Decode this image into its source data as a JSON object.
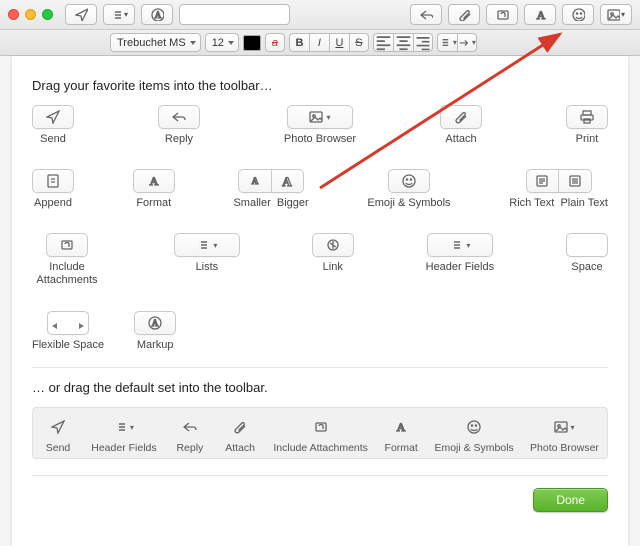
{
  "formatbar": {
    "font": "Trebuchet MS",
    "size": "12"
  },
  "sheet": {
    "instruction": "Drag your favorite items into the toolbar…",
    "or_instruction": "… or drag the default set into the toolbar.",
    "done": "Done"
  },
  "items": {
    "send": "Send",
    "reply": "Reply",
    "photo_browser": "Photo Browser",
    "attach": "Attach",
    "print": "Print",
    "append": "Append",
    "format": "Format",
    "smaller": "Smaller",
    "bigger": "Bigger",
    "emoji": "Emoji & Symbols",
    "rich_text": "Rich Text",
    "plain_text": "Plain Text",
    "include_attachments": "Include Attachments",
    "lists": "Lists",
    "link": "Link",
    "header_fields": "Header Fields",
    "space": "Space",
    "flexible_space": "Flexible Space",
    "markup": "Markup"
  },
  "defaults": {
    "send": "Send",
    "header_fields": "Header Fields",
    "reply": "Reply",
    "attach": "Attach",
    "include_attachments": "Include Attachments",
    "format": "Format",
    "emoji": "Emoji & Symbols",
    "photo_browser": "Photo Browser"
  }
}
